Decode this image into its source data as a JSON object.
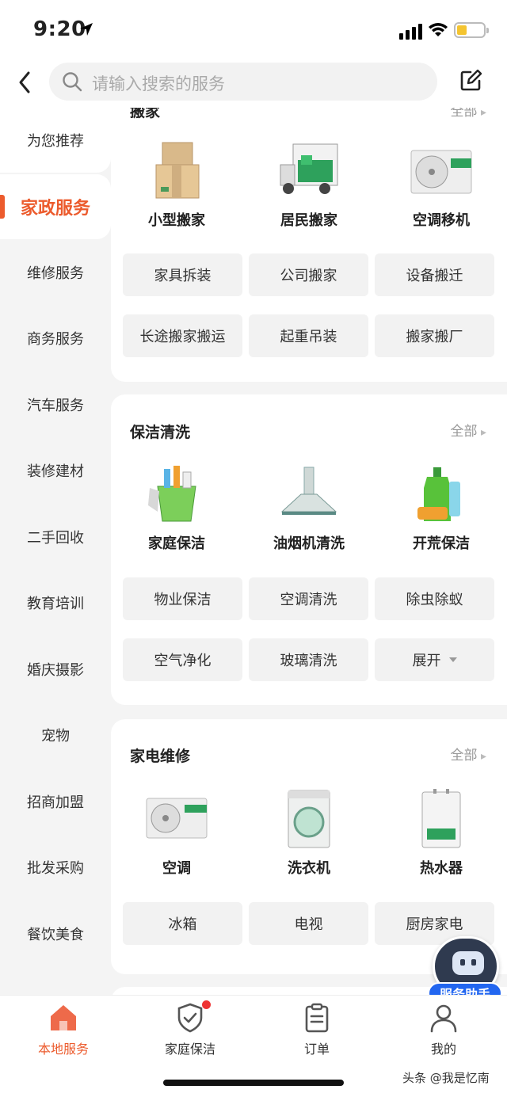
{
  "status": {
    "time": "9:20"
  },
  "search": {
    "placeholder": "请输入搜索的服务"
  },
  "sidebar": {
    "items": [
      {
        "label": "为您推荐"
      },
      {
        "label": "家政服务",
        "active": true
      },
      {
        "label": "维修服务"
      },
      {
        "label": "商务服务"
      },
      {
        "label": "汽车服务"
      },
      {
        "label": "装修建材"
      },
      {
        "label": "二手回收"
      },
      {
        "label": "教育培训"
      },
      {
        "label": "婚庆摄影"
      },
      {
        "label": "宠物"
      },
      {
        "label": "招商加盟"
      },
      {
        "label": "批发采购"
      },
      {
        "label": "餐饮美食"
      }
    ]
  },
  "sections": [
    {
      "title": "搬家",
      "all": "全部",
      "icons": [
        {
          "label": "小型搬家",
          "icon": "boxes-icon"
        },
        {
          "label": "居民搬家",
          "icon": "moving-truck-icon"
        },
        {
          "label": "空调移机",
          "icon": "air-conditioner-icon"
        }
      ],
      "chips": [
        "家具拆装",
        "公司搬家",
        "设备搬迁",
        "长途搬家搬运",
        "起重吊装",
        "搬家搬厂"
      ]
    },
    {
      "title": "保洁清洗",
      "all": "全部",
      "icons": [
        {
          "label": "家庭保洁",
          "icon": "cleaning-bucket-icon"
        },
        {
          "label": "油烟机清洗",
          "icon": "range-hood-icon"
        },
        {
          "label": "开荒保洁",
          "icon": "detergent-bottles-icon"
        }
      ],
      "chips": [
        "物业保洁",
        "空调清洗",
        "除虫除蚁",
        "空气净化",
        "玻璃清洗",
        "展开"
      ]
    },
    {
      "title": "家电维修",
      "all": "全部",
      "icons": [
        {
          "label": "空调",
          "icon": "air-conditioner-icon"
        },
        {
          "label": "洗衣机",
          "icon": "washing-machine-icon"
        },
        {
          "label": "热水器",
          "icon": "water-heater-icon"
        }
      ],
      "chips": [
        "冰箱",
        "电视",
        "厨房家电"
      ]
    }
  ],
  "assistant": {
    "label": "服务助手"
  },
  "tabs": [
    {
      "label": "本地服务",
      "icon": "home-icon",
      "active": true
    },
    {
      "label": "家庭保洁",
      "icon": "shield-check-icon"
    },
    {
      "label": "订单",
      "icon": "clipboard-icon"
    },
    {
      "label": "我的",
      "icon": "user-icon"
    }
  ],
  "watermark": "头条 @我是忆南",
  "colors": {
    "accent": "#ec5b2d",
    "assistant_badge": "#2266f0"
  }
}
